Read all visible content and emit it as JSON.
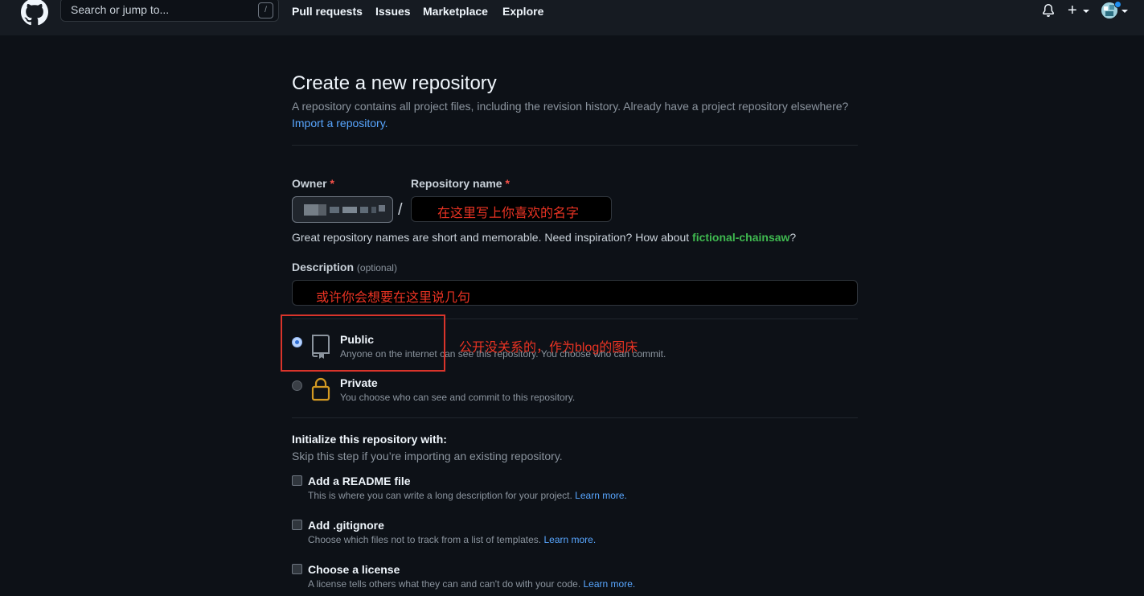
{
  "header": {
    "search_placeholder": "Search or jump to...",
    "search_shortcut": "/",
    "nav": [
      "Pull requests",
      "Issues",
      "Marketplace",
      "Explore"
    ],
    "new_menu": "+"
  },
  "page": {
    "title": "Create a new repository",
    "subtitle": "A repository contains all project files, including the revision history. Already have a project repository elsewhere?",
    "import_link": "Import a repository.",
    "owner_label": "Owner",
    "repo_name_label": "Repository name",
    "required_mark": "*",
    "separator": "/",
    "repo_name_annotation": "在这里写上你喜欢的名字",
    "hint_prefix": "Great repository names are short and memorable. Need inspiration? How about ",
    "hint_suggestion": "fictional-chainsaw",
    "hint_suffix": "?",
    "description_label": "Description",
    "description_optional": "(optional)",
    "description_annotation": "或许你会想要在这里说几句",
    "visibility": {
      "public_title": "Public",
      "public_desc": "Anyone on the internet can see this repository. You choose who can commit.",
      "public_annotation": "公开没关系的，作为blog的图床",
      "private_title": "Private",
      "private_desc": "You choose who can see and commit to this repository.",
      "selected": "Public"
    },
    "init": {
      "title": "Initialize this repository with:",
      "subtitle": "Skip this step if you’re importing an existing repository.",
      "learn_more": "Learn more.",
      "options": [
        {
          "title": "Add a README file",
          "desc": "This is where you can write a long description for your project."
        },
        {
          "title": "Add .gitignore",
          "desc": "Choose which files not to track from a list of templates."
        },
        {
          "title": "Choose a license",
          "desc": "A license tells others what they can and can't do with your code."
        }
      ]
    }
  },
  "colors": {
    "background": "#0d1117",
    "header": "#161b22",
    "link": "#58a6ff",
    "suggestion": "#3fb950",
    "annotation": "#ea3323"
  },
  "icons": [
    "github-logo-icon",
    "bell-icon",
    "plus-icon",
    "repo-icon",
    "lock-icon"
  ]
}
